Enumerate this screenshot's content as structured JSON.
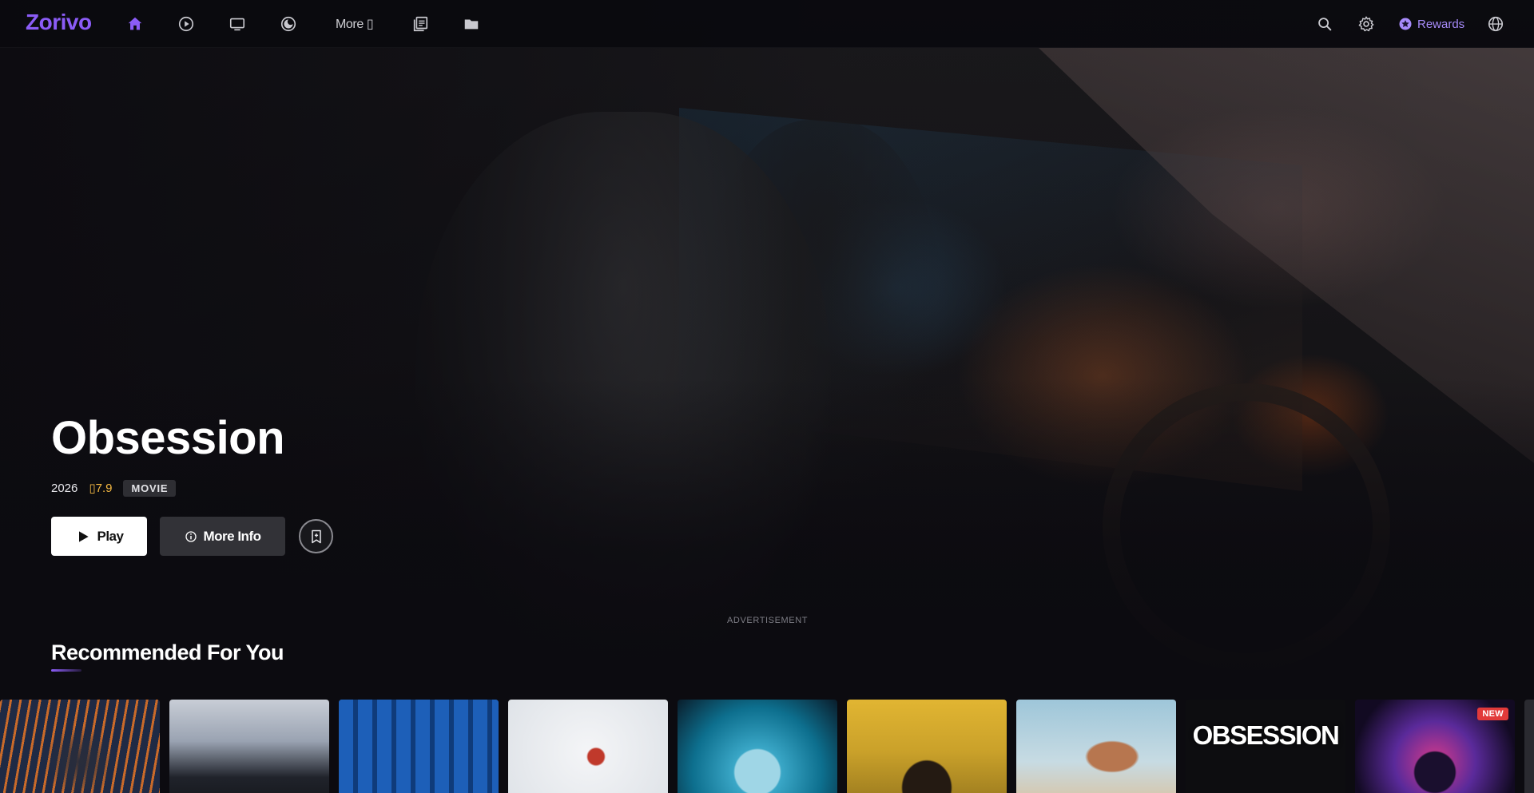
{
  "app": {
    "logo": "Zorivo"
  },
  "nav": {
    "icons": [
      "home-icon",
      "play-circle-icon",
      "tv-icon",
      "anime-icon",
      "library-icon",
      "folder-icon"
    ],
    "more_label": "More ▯",
    "rewards_label": "Rewards",
    "active_color": "#8b5cf6"
  },
  "hero": {
    "title": "Obsession",
    "year": "2026",
    "rating": "▯7.9",
    "type_badge": "MOVIE",
    "play_label": "Play",
    "info_label": "More Info",
    "ad_label": "ADVERTISEMENT"
  },
  "row": {
    "title": "Recommended For You",
    "posters": [
      {
        "name": "poster-1",
        "text": "",
        "badge": ""
      },
      {
        "name": "poster-2",
        "text": "",
        "badge": ""
      },
      {
        "name": "poster-3",
        "text": "",
        "badge": ""
      },
      {
        "name": "poster-4",
        "text": "",
        "badge": ""
      },
      {
        "name": "poster-5",
        "text": "",
        "badge": ""
      },
      {
        "name": "poster-6",
        "text": "",
        "badge": ""
      },
      {
        "name": "poster-7",
        "text": "",
        "badge": ""
      },
      {
        "name": "poster-8",
        "text": "OBSESSION",
        "badge": ""
      },
      {
        "name": "poster-9",
        "text": "",
        "badge": "NEW"
      }
    ]
  },
  "colors": {
    "accent": "#8b5cf6",
    "rating": "#f5b942",
    "badge_new": "#e23a3a"
  }
}
